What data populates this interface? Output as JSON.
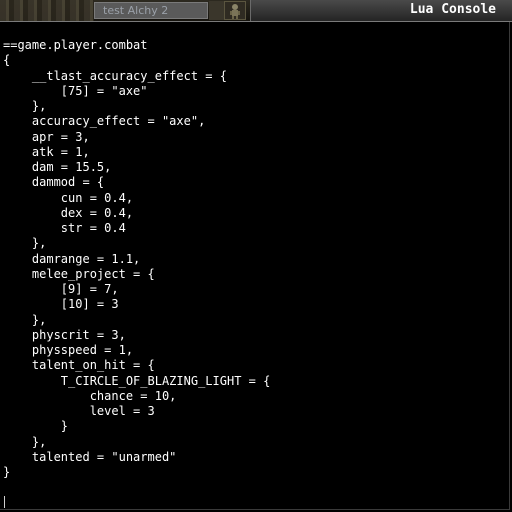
{
  "window": {
    "title": "Lua Console",
    "player_tab_label": "test Alchy 2"
  },
  "icons": {
    "portrait": "character-portrait-icon"
  },
  "console": {
    "lines": [
      "==game.player.combat",
      "{",
      "    __tlast_accuracy_effect = {",
      "        [75] = \"axe\"",
      "    },",
      "    accuracy_effect = \"axe\",",
      "    apr = 3,",
      "    atk = 1,",
      "    dam = 15.5,",
      "    dammod = {",
      "        cun = 0.4,",
      "        dex = 0.4,",
      "        str = 0.4",
      "    },",
      "    damrange = 1.1,",
      "    melee_project = {",
      "        [9] = 7,",
      "        [10] = 3",
      "    },",
      "    physcrit = 3,",
      "    physspeed = 1,",
      "    talent_on_hit = {",
      "        T_CIRCLE_OF_BLAZING_LIGHT = {",
      "            chance = 10,",
      "            level = 3",
      "        }",
      "    },",
      "    talented = \"unarmed\"",
      "}"
    ],
    "input_value": ""
  },
  "colors": {
    "background": "#000000",
    "text": "#ffffff",
    "titlebar": "#3a3a3a"
  }
}
